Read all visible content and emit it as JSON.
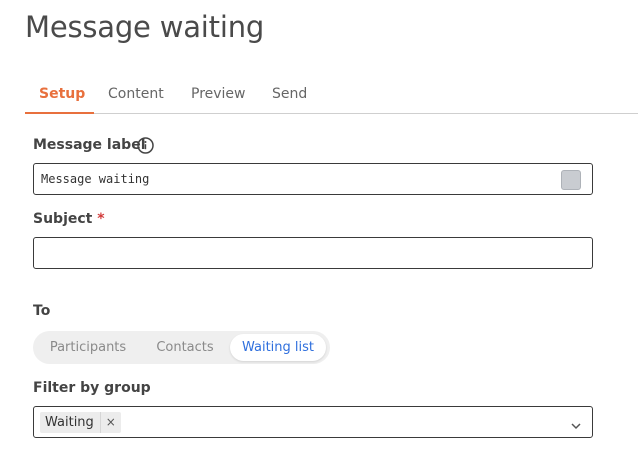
{
  "page": {
    "title": "Message waiting"
  },
  "tabs": [
    {
      "label": "Setup",
      "active": true
    },
    {
      "label": "Content",
      "active": false
    },
    {
      "label": "Preview",
      "active": false
    },
    {
      "label": "Send",
      "active": false
    }
  ],
  "message_label": {
    "label": "Message label",
    "value": "Message waiting",
    "icon": "info-icon"
  },
  "subject": {
    "label": "Subject",
    "required_mark": "*",
    "value": ""
  },
  "recipients": {
    "label": "To",
    "options": [
      "Participants",
      "Contacts",
      "Waiting list"
    ],
    "selected": "Waiting list"
  },
  "filter": {
    "label": "Filter by group",
    "chips": [
      {
        "label": "Waiting",
        "remove": "×"
      }
    ],
    "icon": "chevron-down-icon"
  },
  "colors": {
    "accent": "#e8703d",
    "selected_segment": "#2f6fdd",
    "required": "#d23a3a"
  }
}
